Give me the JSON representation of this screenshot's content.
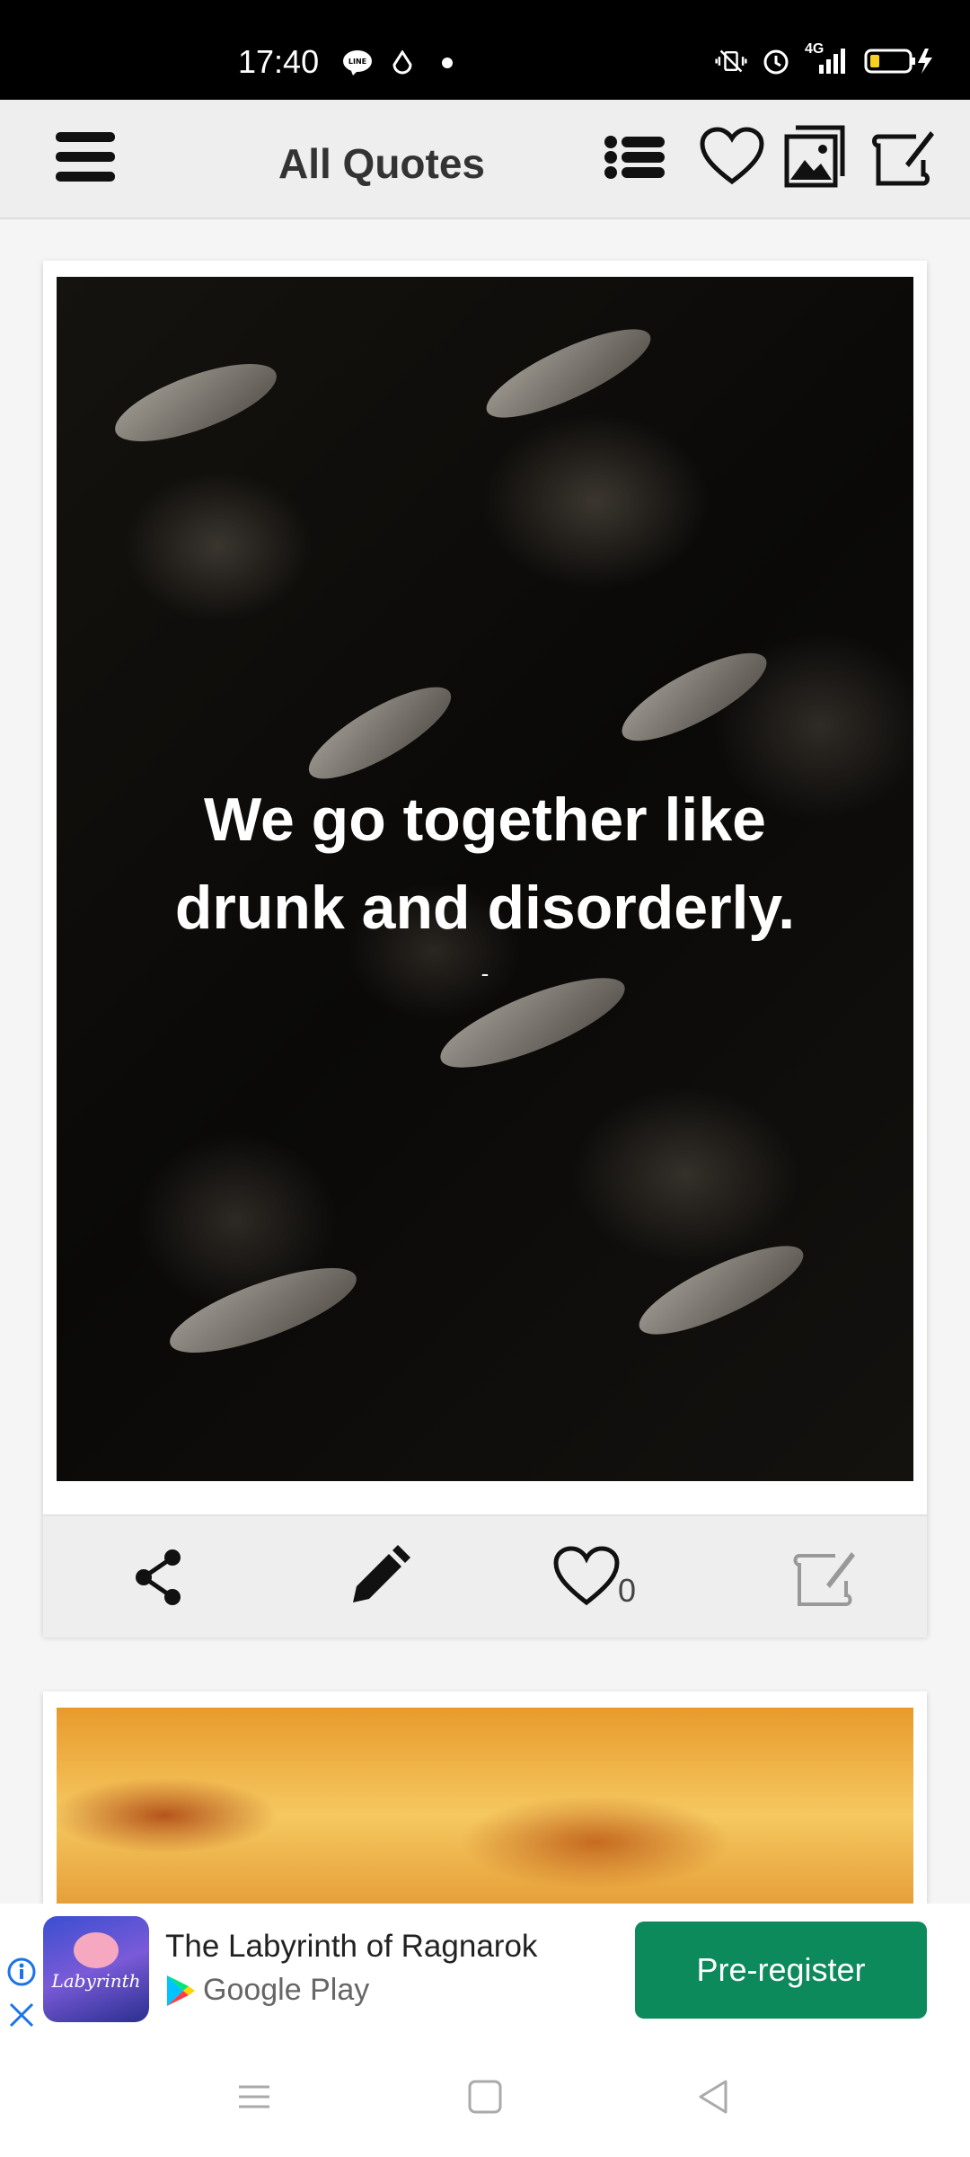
{
  "status_bar": {
    "time": "17:40",
    "left_icons": [
      "line-icon",
      "drop-icon",
      "dot-icon"
    ],
    "right_icons": [
      "vibrate-icon",
      "alarm-icon",
      "signal-4g-icon",
      "battery-icon"
    ],
    "network_label": "4G"
  },
  "app_bar": {
    "title": "All Quotes",
    "icons": [
      "menu-icon",
      "list-icon",
      "heart-icon",
      "gallery-icon",
      "edit-icon"
    ]
  },
  "quote_card": {
    "quote_line1": "We go together like",
    "quote_line2": "drunk and disorderly.",
    "author": "-",
    "like_count": "0",
    "actions": [
      "share-icon",
      "pencil-icon",
      "heart-icon",
      "edit-note-icon"
    ]
  },
  "ad": {
    "title": "The Labyrinth of Ragnarok",
    "store": "Google Play",
    "cta": "Pre-register",
    "icon_text": "Labyrinth",
    "colors": {
      "cta": "#0d8a5c"
    }
  },
  "nav_bar": {
    "buttons": [
      "recents-icon",
      "home-icon",
      "back-icon"
    ]
  }
}
